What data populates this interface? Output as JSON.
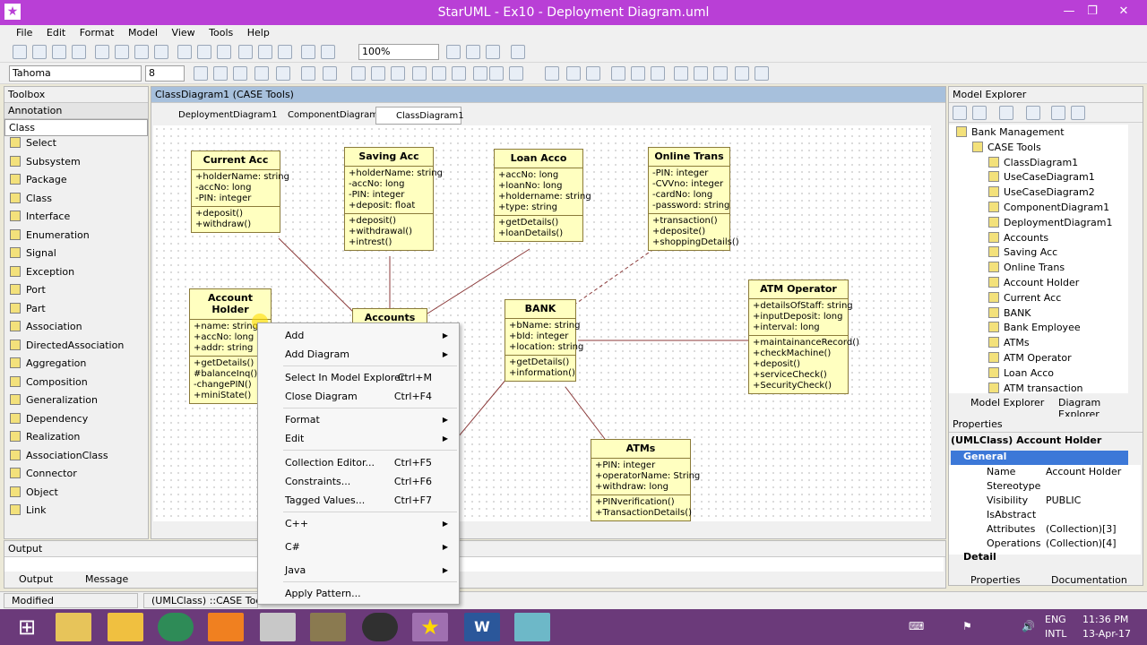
{
  "window": {
    "title": "StarUML - Ex10 - Deployment Diagram.uml"
  },
  "menu": [
    "File",
    "Edit",
    "Format",
    "Model",
    "View",
    "Tools",
    "Help"
  ],
  "toolbar": {
    "zoom": "100%",
    "font": "Tahoma",
    "font_size": "8"
  },
  "toolbox": {
    "title": "Toolbox",
    "sections": [
      "Annotation",
      "Class"
    ],
    "items": [
      "Select",
      "Subsystem",
      "Package",
      "Class",
      "Interface",
      "Enumeration",
      "Signal",
      "Exception",
      "Port",
      "Part",
      "Association",
      "DirectedAssociation",
      "Aggregation",
      "Composition",
      "Generalization",
      "Dependency",
      "Realization",
      "AssociationClass",
      "Connector",
      "Object",
      "Link"
    ]
  },
  "editor": {
    "header": "ClassDiagram1 (CASE Tools)",
    "tabs": [
      "DeploymentDiagram1",
      "ComponentDiagram1",
      "ClassDiagram1"
    ]
  },
  "classes": [
    {
      "name": "Current Acc",
      "attrs": [
        "+holderName: string",
        "-accNo: long",
        "-PIN: integer"
      ],
      "ops": [
        "+deposit()",
        "+withdraw()"
      ]
    },
    {
      "name": "Saving Acc",
      "attrs": [
        "+holderName: string",
        "-accNo: long",
        "-PIN: integer",
        "+deposit: float"
      ],
      "ops": [
        "+deposit()",
        "+withdrawal()",
        "+intrest()"
      ]
    },
    {
      "name": "Loan Acco",
      "attrs": [
        "+accNo: long",
        "+loanNo: long",
        "+holdername: string",
        "+type: string"
      ],
      "ops": [
        "+getDetails()",
        "+loanDetails()"
      ]
    },
    {
      "name": "Online Trans",
      "attrs": [
        "-PIN: integer",
        "-CVVno: integer",
        "-cardNo: long",
        "-password: string"
      ],
      "ops": [
        "+transaction()",
        "+deposite()",
        "+shoppingDetails()"
      ]
    },
    {
      "name": "Account Holder",
      "attrs": [
        "+name: string",
        "+accNo: long",
        "+addr: string"
      ],
      "ops": [
        "+getDetails()",
        "#balanceInq()",
        "-changePIN()",
        "+miniState()"
      ]
    },
    {
      "name": "Accounts",
      "attrs": [],
      "ops": []
    },
    {
      "name": "BANK",
      "attrs": [
        "+bName: string",
        "+bId: integer",
        "+location: string"
      ],
      "ops": [
        "+getDetails()",
        "+information()"
      ]
    },
    {
      "name": "ATM Operator",
      "attrs": [
        "+detailsOfStaff: string",
        "+inputDeposit: long",
        "+interval: long"
      ],
      "ops": [
        "+maintainanceRecord()",
        "+checkMachine()",
        "+deposit()",
        "+serviceCheck()",
        "+SecurityCheck()"
      ]
    },
    {
      "name": "ATMs",
      "attrs": [
        "+PIN: integer",
        "+operatorName: String",
        "+withdraw: long"
      ],
      "ops": [
        "+PINverification()",
        "+TransactionDetails()"
      ]
    }
  ],
  "context_menu": [
    {
      "label": "Add",
      "shortcut": "",
      "sub": true
    },
    {
      "label": "Add Diagram",
      "shortcut": "",
      "sub": true
    },
    {
      "label": "Select In Model Explorer",
      "shortcut": "Ctrl+M",
      "sub": false
    },
    {
      "label": "Close Diagram",
      "shortcut": "Ctrl+F4",
      "sub": false
    },
    {
      "label": "Format",
      "shortcut": "",
      "sub": true
    },
    {
      "label": "Edit",
      "shortcut": "",
      "sub": true
    },
    {
      "label": "Collection Editor...",
      "shortcut": "Ctrl+F5",
      "sub": false
    },
    {
      "label": "Constraints...",
      "shortcut": "Ctrl+F6",
      "sub": false
    },
    {
      "label": "Tagged Values...",
      "shortcut": "Ctrl+F7",
      "sub": false
    },
    {
      "label": "C++",
      "shortcut": "",
      "sub": true
    },
    {
      "label": "C#",
      "shortcut": "",
      "sub": true
    },
    {
      "label": "Java",
      "shortcut": "",
      "sub": true
    },
    {
      "label": "Apply Pattern...",
      "shortcut": "",
      "sub": false
    }
  ],
  "model_explorer": {
    "title": "Model Explorer",
    "tree": [
      {
        "label": "Bank Management",
        "level": 0
      },
      {
        "label": "CASE Tools",
        "level": 1
      },
      {
        "label": "ClassDiagram1",
        "level": 2
      },
      {
        "label": "UseCaseDiagram1",
        "level": 2
      },
      {
        "label": "UseCaseDiagram2",
        "level": 2
      },
      {
        "label": "ComponentDiagram1",
        "level": 2
      },
      {
        "label": "DeploymentDiagram1",
        "level": 2
      },
      {
        "label": "Accounts",
        "level": 2
      },
      {
        "label": "Saving Acc",
        "level": 2
      },
      {
        "label": "Online Trans",
        "level": 2
      },
      {
        "label": "Account Holder",
        "level": 2
      },
      {
        "label": "Current Acc",
        "level": 2
      },
      {
        "label": "BANK",
        "level": 2
      },
      {
        "label": "Bank Employee",
        "level": 2
      },
      {
        "label": "ATMs",
        "level": 2
      },
      {
        "label": "ATM Operator",
        "level": 2
      },
      {
        "label": "Loan Acco",
        "level": 2
      },
      {
        "label": "ATM transaction",
        "level": 2
      }
    ],
    "tabs": [
      "Model Explorer",
      "Diagram Explorer"
    ]
  },
  "properties": {
    "title": "Properties",
    "subject": "(UMLClass) Account Holder",
    "group": "General",
    "rows": [
      {
        "k": "Name",
        "v": "Account Holder"
      },
      {
        "k": "Stereotype",
        "v": ""
      },
      {
        "k": "Visibility",
        "v": "PUBLIC"
      },
      {
        "k": "IsAbstract",
        "v": ""
      },
      {
        "k": "Attributes",
        "v": "(Collection)[3]"
      },
      {
        "k": "Operations",
        "v": "(Collection)[4]"
      }
    ],
    "detail": "Detail",
    "tabs": [
      "Properties",
      "Documentation"
    ]
  },
  "output": {
    "title": "Output",
    "tabs": [
      "Output",
      "Message"
    ]
  },
  "status": {
    "left": "Modified",
    "mid": "(UMLClass) ::CASE Tools"
  },
  "taskbar": {
    "lang": "ENG",
    "layout": "INTL",
    "time": "11:36 PM",
    "date": "13-Apr-17"
  }
}
